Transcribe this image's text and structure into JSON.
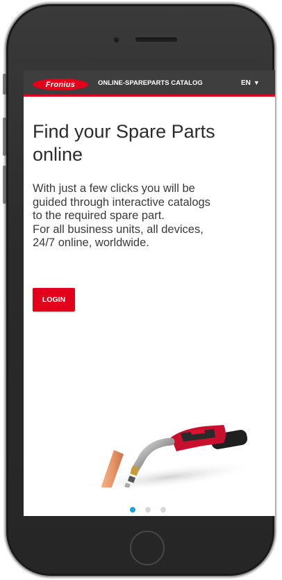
{
  "header": {
    "logo_text": "Fronius",
    "catalog_title": "ONLINE-SPAREPARTS CATALOG",
    "language": "EN",
    "language_icon": "triangle-down-icon"
  },
  "hero": {
    "headline_lines": [
      "Find your Spare Parts",
      "online"
    ],
    "body_lines": [
      "With just a few clicks you will be",
      "guided through interactive catalogs",
      "to the required spare part.",
      "For all business units, all devices,",
      "24/7 online, worldwide."
    ],
    "login_label": "LOGIN"
  },
  "carousel": {
    "slide_count": 3,
    "active_index": 0
  },
  "colors": {
    "brand_red": "#e2001a",
    "topbar": "#3e3e3e",
    "dot_active": "#1aa0dc",
    "dot_inactive": "#d8d8d8"
  }
}
